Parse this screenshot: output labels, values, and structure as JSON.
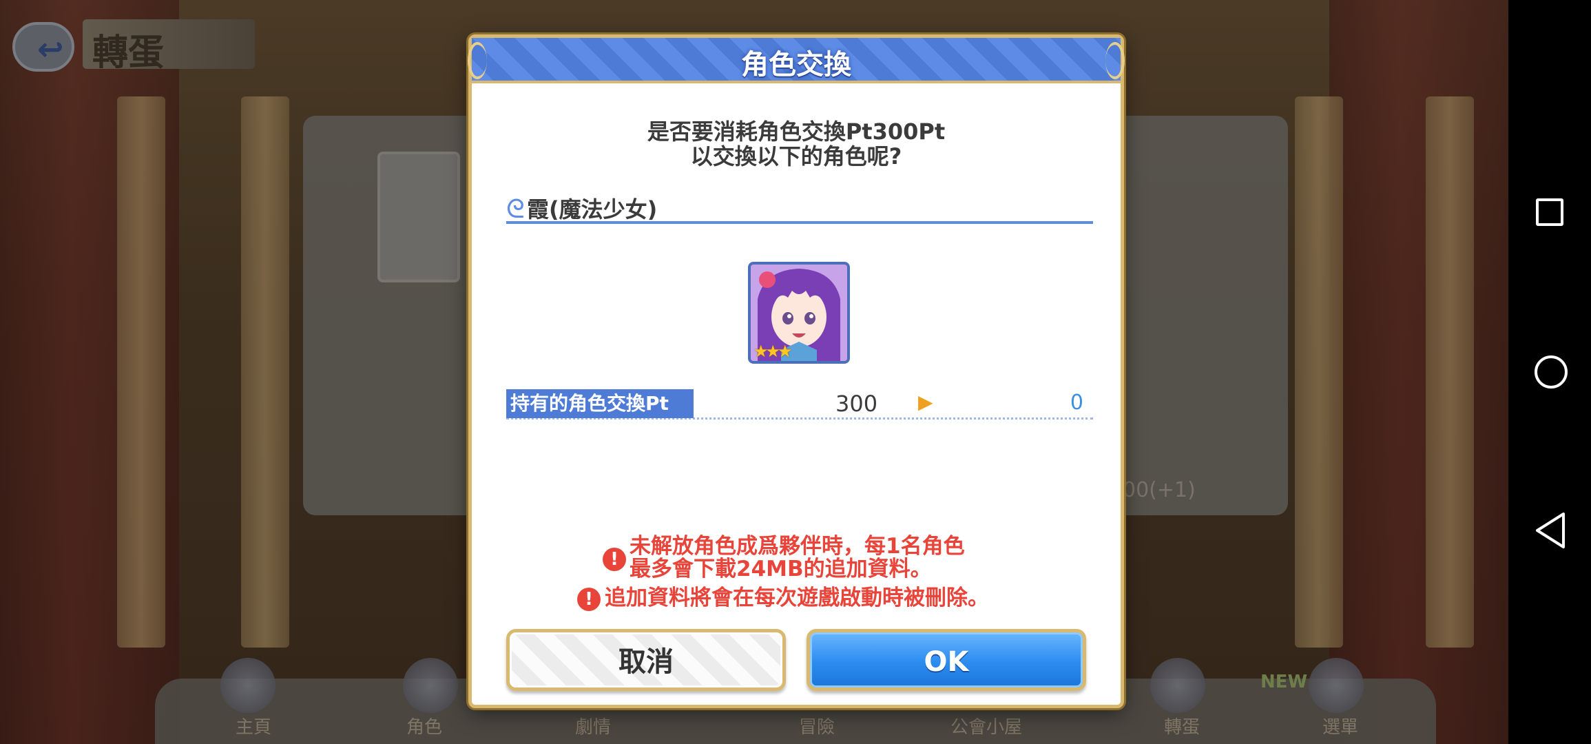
{
  "background": {
    "top_title": "轉蛋",
    "stage_label": "00(+1)",
    "nav": [
      "主頁",
      "角色",
      "劇情",
      "冒險",
      "公會小屋",
      "轉蛋",
      "選單"
    ],
    "nav_badge": "NEW"
  },
  "dialog": {
    "title": "角色交換",
    "prompt_line1": "是否要消耗角色交換Pt300Pt",
    "prompt_line2": "以交換以下的角色呢?",
    "character_name": "霞(魔法少女)",
    "character_stars": "★★★",
    "points_label": "持有的角色交換Pt",
    "points_current": "300",
    "points_after": "0",
    "warning1_line1": "未解放角色成爲夥伴時，每1名角色",
    "warning1_line2": "最多會下載24MB的追加資料。",
    "warning2": "追加資料將會在每次遊戲啟動時被刪除。",
    "cancel_label": "取消",
    "ok_label": "OK"
  },
  "colors": {
    "accent_blue": "#4d7bd6",
    "gold_border": "#d9b96f",
    "warning_red": "#e8443a",
    "ok_button": "#2b8cf0"
  },
  "icons": [
    "back-arrow-icon",
    "warning-icon",
    "recents-square-icon",
    "home-circle-icon",
    "back-triangle-icon"
  ]
}
